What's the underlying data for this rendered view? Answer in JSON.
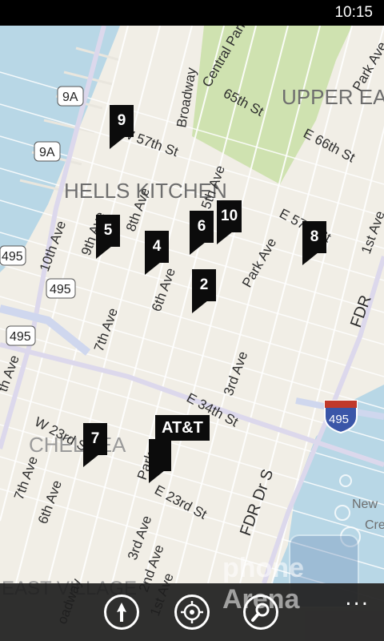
{
  "status": {
    "time": "10:15"
  },
  "map": {
    "district_labels": [
      "HELLS KITCHEN",
      "UPPER EA",
      "CHELSEA",
      "EAST VILLAGE",
      "New",
      "Cre"
    ],
    "street_labels": [
      "Broadway",
      "Central Park W",
      "65th St",
      "E 66th St",
      "Park Ave",
      "W 57th St",
      "9th Ave",
      "8th Ave",
      "10th Ave",
      "6th Ave",
      "5th Ave",
      "E 57th St",
      "1st Ave",
      "Park Ave",
      "7th Ave",
      "3rd Ave",
      "FDR",
      "E 34th St",
      "th Ave",
      "W 23rd St",
      "7th Ave",
      "6th Ave",
      "Park",
      "E 23rd St",
      "FDR Dr S",
      "3rd Ave",
      "2nd Ave",
      "1st Ave",
      "oadway"
    ],
    "shields": [
      "9A",
      "9A",
      "495",
      "495",
      "495",
      "495"
    ]
  },
  "pins": [
    "9",
    "5",
    "4",
    "6",
    "10",
    "8",
    "2",
    "7",
    "AT&T"
  ],
  "watermark": "phone Arena",
  "app_bar": {
    "icons": [
      "directions-icon",
      "locate-me-icon",
      "search-icon"
    ],
    "more": "..."
  }
}
